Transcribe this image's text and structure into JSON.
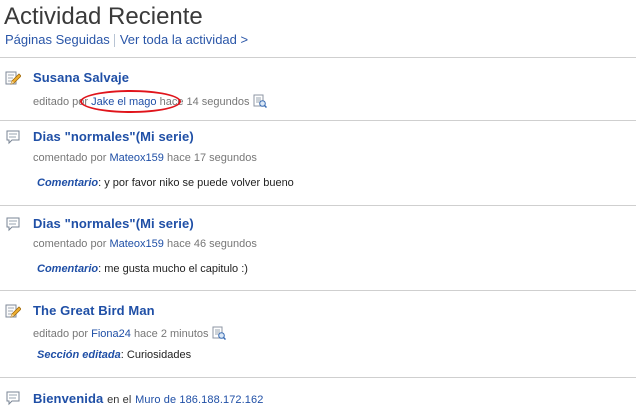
{
  "header": {
    "title": "Actividad Reciente",
    "followed_pages": "Páginas Seguidas",
    "see_all": "Ver toda la actividad >"
  },
  "items": [
    {
      "icon": "edit-icon",
      "title": "Susana Salvaje",
      "meta_prefix": "editado por",
      "user": "Jake el mago",
      "time": "hace 14 segundos",
      "has_diff": true
    },
    {
      "icon": "comment-icon",
      "title": "Dias \"normales\"(Mi serie)",
      "meta_prefix": "comentado por",
      "user": "Mateox159",
      "time": "hace 17 segundos",
      "detail_label": "Comentario",
      "detail_text": ": y por favor niko se puede volver bueno"
    },
    {
      "icon": "comment-icon",
      "title": "Dias \"normales\"(Mi serie)",
      "meta_prefix": "comentado por",
      "user": "Mateox159",
      "time": "hace 46 segundos",
      "detail_label": "Comentario",
      "detail_text": ": me gusta mucho el capitulo :)"
    },
    {
      "icon": "edit-icon",
      "title": "The Great Bird Man",
      "meta_prefix": "editado por",
      "user": "Fiona24",
      "time": "hace 2 minutos",
      "has_diff": true,
      "detail_label": "Sección editada",
      "detail_text": ": Curiosidades"
    },
    {
      "icon": "comment-icon",
      "title": "Bienvenida",
      "inline_text": "en el",
      "inline_link": "Muro de 186.188.172.162"
    }
  ],
  "colors": {
    "link": "#1f4fa6",
    "annotation": "#e0141b",
    "divider": "#cfcfcf"
  }
}
